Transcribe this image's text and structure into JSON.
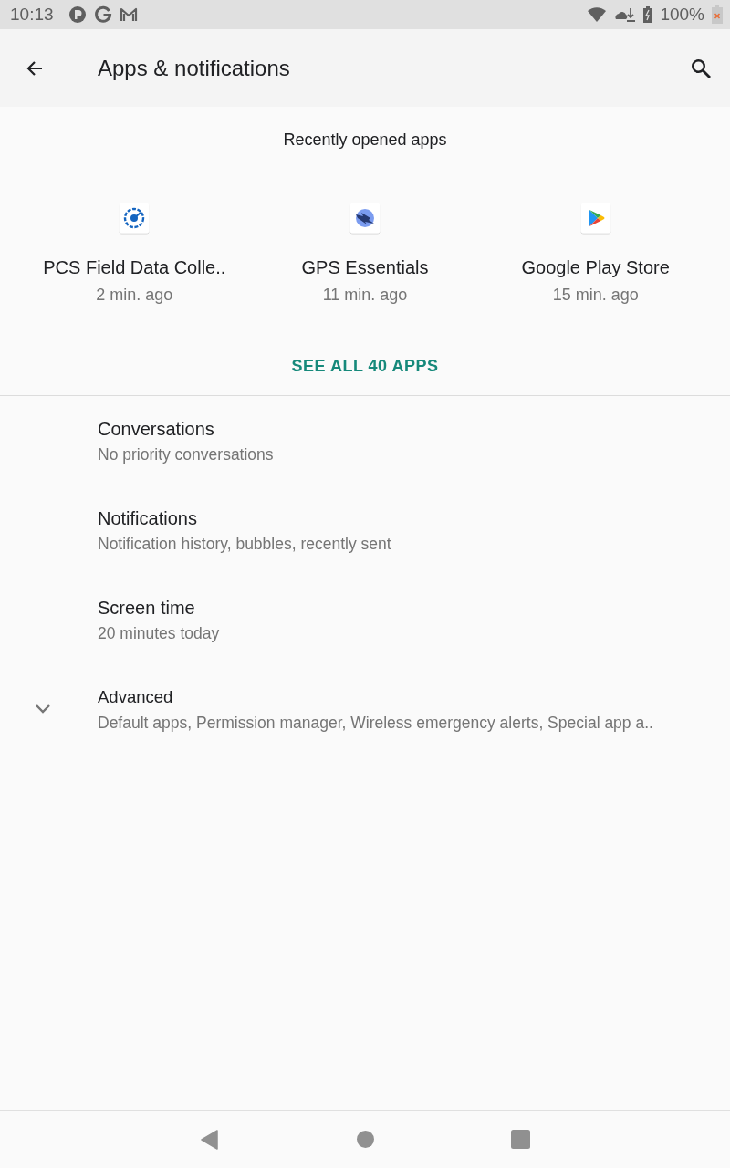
{
  "status_bar": {
    "time": "10:13",
    "battery": "100%"
  },
  "toolbar": {
    "title": "Apps & notifications"
  },
  "recent_apps": {
    "heading": "Recently opened apps",
    "apps": [
      {
        "name": "PCS Field Data Colle..",
        "time": "2 min. ago"
      },
      {
        "name": "GPS Essentials",
        "time": "11 min. ago"
      },
      {
        "name": "Google Play Store",
        "time": "15 min. ago"
      }
    ],
    "see_all": "SEE ALL 40 APPS"
  },
  "settings": [
    {
      "kind": "link",
      "title": "Conversations",
      "summary": "No priority conversations"
    },
    {
      "kind": "link",
      "title": "Notifications",
      "summary": "Notification history, bubbles, recently sent"
    },
    {
      "kind": "link",
      "title": "Screen time",
      "summary": "20 minutes today"
    },
    {
      "kind": "expandable",
      "expanded": false,
      "title": "Advanced",
      "summary": "Default apps, Permission manager, Wireless emergency alerts, Special app a.."
    }
  ]
}
